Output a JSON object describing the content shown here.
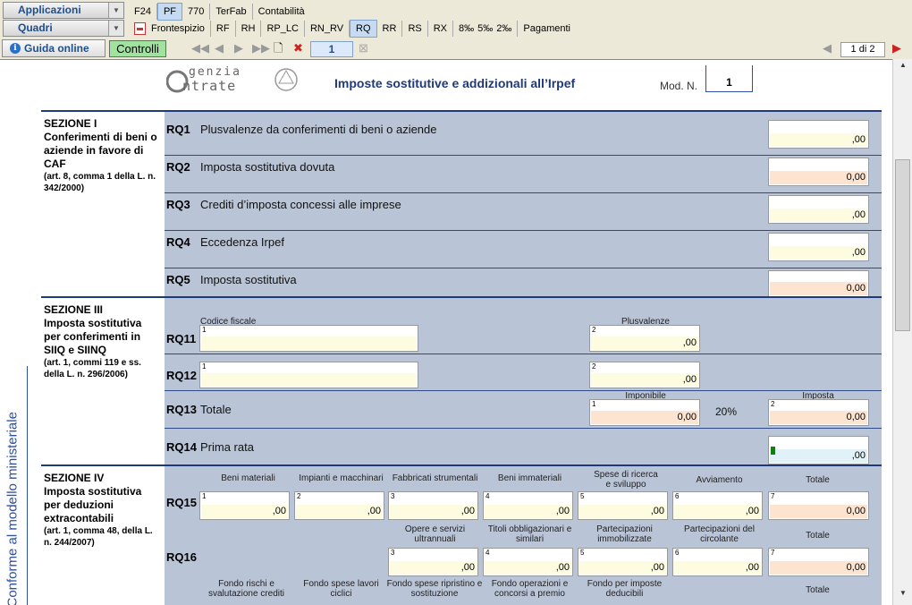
{
  "toolbar": {
    "applicazioni": "Applicazioni",
    "quadri": "Quadri",
    "tabs_row1": [
      "F24",
      "PF",
      "770",
      "TerFab",
      "Contabilità"
    ],
    "tabs_row1_selected": "PF",
    "tabs_row2": [
      "Frontespizio",
      "RF",
      "RH",
      "RP_LC",
      "RN_RV",
      "RQ",
      "RR",
      "RS",
      "RX",
      "8‰",
      "5‰",
      "2‰",
      "Pagamenti"
    ],
    "tabs_row2_selected": "RQ",
    "guida_online": "Guida online",
    "controlli": "Controlli",
    "page_number": "1",
    "page_count": "1 di 2"
  },
  "header": {
    "logo_line1": "genzia",
    "logo_line2": "ntrate",
    "title": "Imposte sostitutive e addizionali all’Irpef",
    "mod_label": "Mod. N.",
    "mod_value": "1"
  },
  "side_label": "Conforme al modello ministeriale",
  "sezione1": {
    "title": "SEZIONE I",
    "subtitle": "Conferimenti di beni o aziende in favore di CAF",
    "ref": "(art. 8, comma 1 della L. n. 342/2000)",
    "rows": [
      {
        "code": "RQ1",
        "label": "Plusvalenze da conferimenti di beni o aziende",
        "value": ",00"
      },
      {
        "code": "RQ2",
        "label": "Imposta sostitutiva dovuta",
        "value": "0,00"
      },
      {
        "code": "RQ3",
        "label": "Crediti d’imposta concessi alle imprese",
        "value": ",00"
      },
      {
        "code": "RQ4",
        "label": "Eccedenza Irpef",
        "value": ",00"
      },
      {
        "code": "RQ5",
        "label": "Imposta sostitutiva",
        "value": "0,00"
      }
    ]
  },
  "sezione3": {
    "title": "SEZIONE III",
    "subtitle": "Imposta sostitutiva per conferimenti in SIIQ e SIINQ",
    "ref": "(art. 1, commi 119 e ss. della L. n. 296/2006)",
    "cap_cf": "Codice fiscale",
    "cap_plus": "Plusvalenze",
    "cap_imponibile": "Imponibile",
    "cap_imposta": "Imposta",
    "rq11_code": "RQ11",
    "rq12_code": "RQ12",
    "rq13_code": "RQ13",
    "rq13_label": "Totale",
    "rq14_code": "RQ14",
    "rq14_label": "Prima rata",
    "plus_value": ",00",
    "imponibile_value": "0,00",
    "percent": "20%",
    "imposta_value": "0,00",
    "prima_rata_value": ",00"
  },
  "sezione4": {
    "title": "SEZIONE IV",
    "subtitle": "Imposta sostitutiva per deduzioni extracontabili",
    "ref": "(art. 1, comma 48, della L. n. 244/2007)",
    "rq15_code": "RQ15",
    "rq16_code": "RQ16",
    "rq15_caps": [
      "Beni materiali",
      "Impianti e macchinari",
      "Fabbricati strumentali",
      "Beni immateriali",
      "Spese di ricerca e sviluppo",
      "Avviamento",
      "Totale"
    ],
    "rq16_caps": [
      "Opere e servizi ultrannuali",
      "Titoli obbligazionari e similari",
      "Partecipazioni immobilizzate",
      "Partecipazioni del circolante",
      "Totale"
    ],
    "rq17_caps": [
      "Fondo rischi e svalutazione crediti",
      "Fondo spese lavori ciclici",
      "Fondo spese ripristino e sostituzione",
      "Fondo operazioni e concorsi a premio",
      "Fondo per imposte deducibili",
      "Totale"
    ],
    "cell_value": ",00",
    "total_value": "0,00"
  },
  "numbers": [
    "1",
    "2",
    "3",
    "4",
    "5",
    "6",
    "7"
  ]
}
